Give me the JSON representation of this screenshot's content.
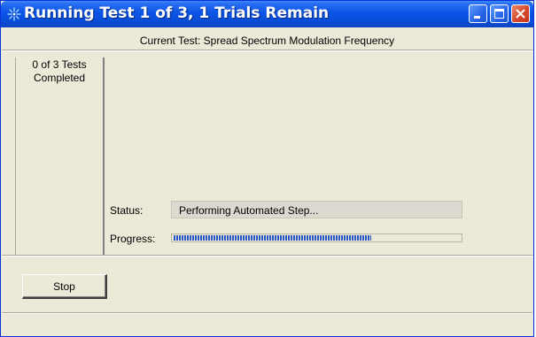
{
  "window": {
    "title": "Running Test 1 of 3, 1 Trials Remain",
    "controls": [
      "minimize-icon",
      "maximize-icon",
      "close-icon"
    ]
  },
  "current_test": "Current Test: Spread Spectrum Modulation Frequency",
  "tests_completed": {
    "line1": "0 of 3 Tests",
    "line2": "Completed"
  },
  "status": {
    "label": "Status:",
    "value": "Performing Automated Step..."
  },
  "progress": {
    "label": "Progress:",
    "fraction": 0.69
  },
  "actions": {
    "stop_label": "Stop"
  },
  "colors": {
    "titlebar": "#0a54e6",
    "window_face": "#ece9d8",
    "progress_fill": "#2a56c8"
  }
}
